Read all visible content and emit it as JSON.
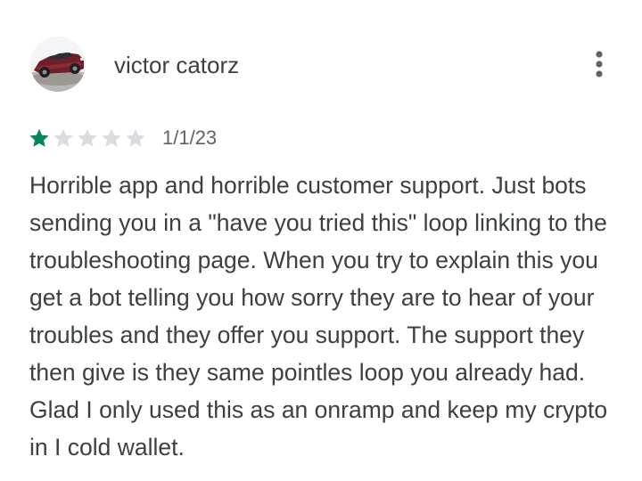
{
  "review": {
    "author_name": "victor catorz",
    "avatar_icon": "car-photo-avatar",
    "more_icon": "more-vertical-icon",
    "rating": 1,
    "rating_max": 5,
    "star_filled_color": "#01875f",
    "star_empty_color": "#dadce0",
    "date": "1/1/23",
    "text": "Horrible app and horrible customer support. Just bots sending you in a \"have you tried this\" loop linking to the troubleshooting page. When you try to explain this you get a bot telling you how sorry they are to hear of your troubles and they offer you support. The support they then give is they same pointles loop you already had. Glad I only used this as an onramp and keep my crypto in I cold wallet."
  }
}
